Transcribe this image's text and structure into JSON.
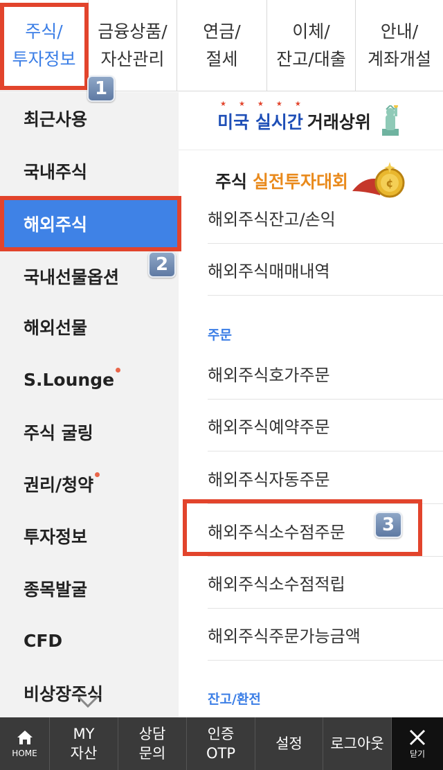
{
  "top_tabs": [
    {
      "label": "주식/\n투자정보",
      "active": true
    },
    {
      "label": "금융상품/\n자산관리",
      "active": false
    },
    {
      "label": "연금/\n절세",
      "active": false
    },
    {
      "label": "이체/\n잔고/대출",
      "active": false
    },
    {
      "label": "안내/\n계좌개설",
      "active": false
    }
  ],
  "steps": {
    "one": "1",
    "two": "2",
    "three": "3"
  },
  "left_menu": [
    {
      "label": "최근사용"
    },
    {
      "label": "국내주식"
    },
    {
      "label": "해외주식",
      "active": true
    },
    {
      "label": "국내선물옵션"
    },
    {
      "label": "해외선물"
    },
    {
      "label": "S.Lounge",
      "dot": true
    },
    {
      "label": "주식 굴링"
    },
    {
      "label": "권리/청약",
      "dot": true
    },
    {
      "label": "투자정보"
    },
    {
      "label": "종목발굴"
    },
    {
      "label": "CFD"
    },
    {
      "label": "비상장주식"
    }
  ],
  "banners": {
    "realtime": {
      "part1": "미국 실시간",
      "part2": "거래상위"
    },
    "contest": {
      "part1": "주식",
      "part2": "실전투자대회"
    }
  },
  "right_menu": {
    "items_top": [
      "해외주식잔고/손익",
      "해외주식매매내역"
    ],
    "order_section": "주문",
    "order_items": [
      "해외주식호가주문",
      "해외주식예약주문",
      "해외주식자동주문",
      "해외주식소수점주문",
      "해외주식소수점적립",
      "해외주식주문가능금액"
    ],
    "balance_section": "잔고/환전"
  },
  "bottom_bar": {
    "home": "HOME",
    "my_assets": "MY\n자산",
    "consult": "상담\n문의",
    "otp": "인증\nOTP",
    "settings": "설정",
    "logout": "로그아웃",
    "close": "닫기"
  },
  "colors": {
    "accent": "#3f82e6",
    "highlight": "#e2442c",
    "bottom_bar": "#3a3a3a"
  }
}
